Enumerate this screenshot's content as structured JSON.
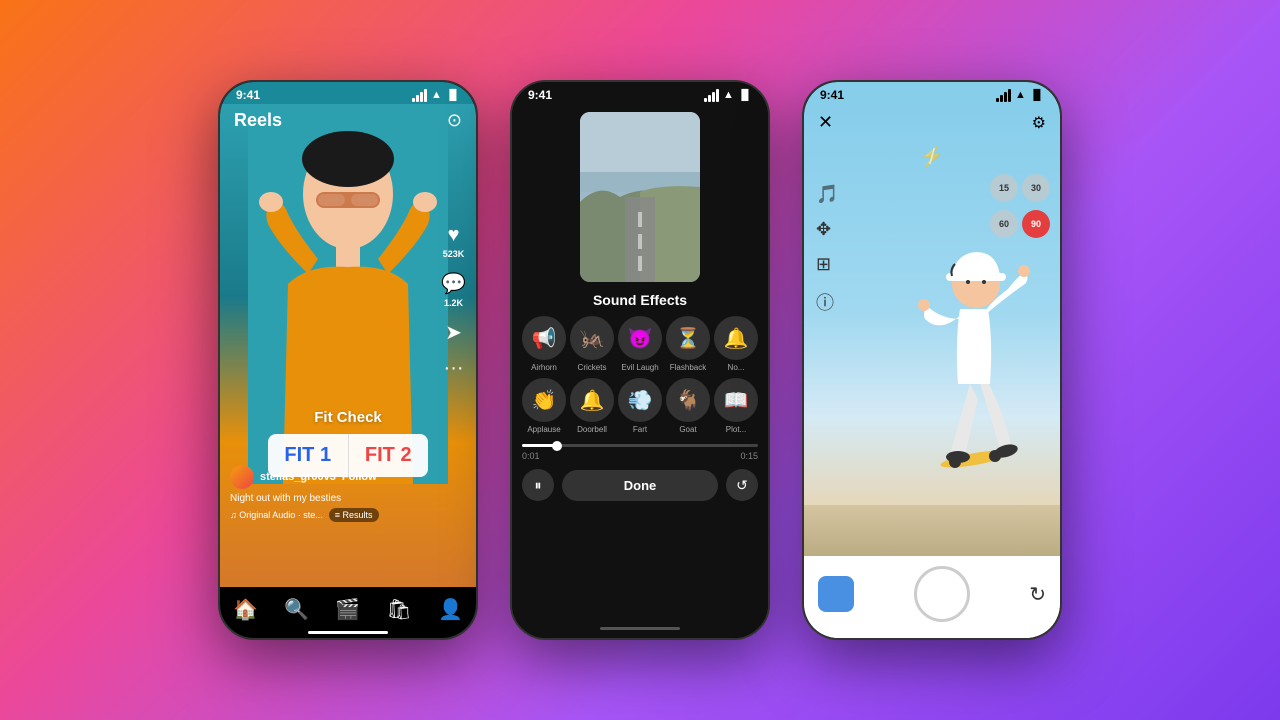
{
  "phone1": {
    "status_time": "9:41",
    "title": "Reels",
    "fit_check_label": "Fit Check",
    "fit1_label": "FIT 1",
    "fit2_label": "FIT 2",
    "username": "stellas_gr00v3",
    "follow_label": "Follow",
    "caption": "Night out with my besties",
    "audio_label": "♫ Original Audio · ste...",
    "results_label": "≡ Results",
    "like_count": "523K",
    "comment_count": "1.2K",
    "nav": [
      "🏠",
      "🔍",
      "🎬",
      "🛍",
      "👤"
    ]
  },
  "phone2": {
    "status_time": "9:41",
    "sound_effects_title": "Sound Effects",
    "effects_row1": [
      {
        "icon": "📢",
        "label": "Airhorn"
      },
      {
        "icon": "🦗",
        "label": "Crickets"
      },
      {
        "icon": "😈",
        "label": "Evil Laugh"
      },
      {
        "icon": "⏳",
        "label": "Flashback"
      },
      {
        "icon": "🔔",
        "label": "No..."
      }
    ],
    "effects_row2": [
      {
        "icon": "👏",
        "label": "Applause"
      },
      {
        "icon": "🔔",
        "label": "Doorbell"
      },
      {
        "icon": "💨",
        "label": "Fart"
      },
      {
        "icon": "🐐",
        "label": "Goat"
      },
      {
        "icon": "📖",
        "label": "Plot..."
      }
    ],
    "time_start": "0:01",
    "time_end": "0:15",
    "done_label": "Done"
  },
  "phone3": {
    "status_time": "9:41",
    "timer_options": [
      "15",
      "30",
      "60",
      "90"
    ],
    "active_timer": "90"
  }
}
